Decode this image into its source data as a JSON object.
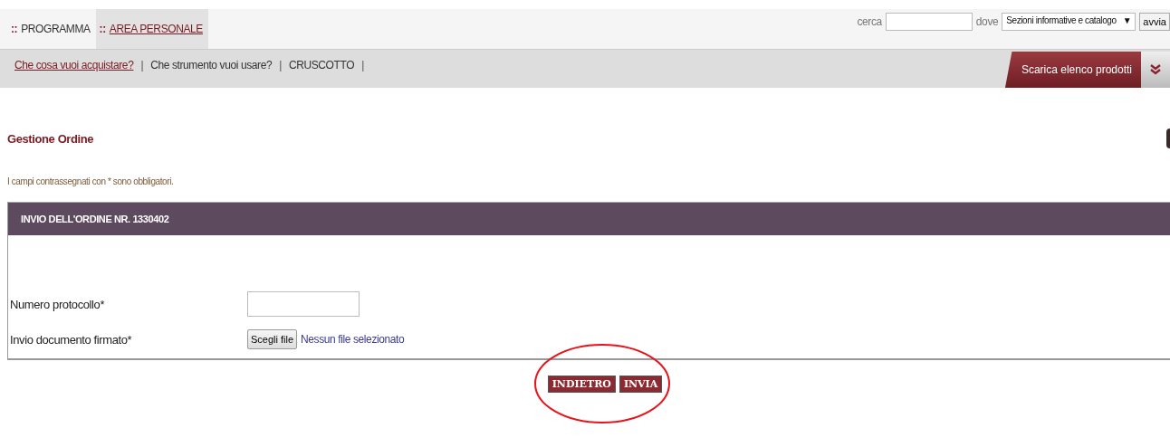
{
  "tabs": [
    {
      "marker": "::",
      "label": "PROGRAMMA",
      "selected": false
    },
    {
      "marker": "::",
      "label": "AREA PERSONALE",
      "selected": true
    }
  ],
  "search": {
    "label": "cerca",
    "where_label": "dove",
    "scope": "Sezioni informative e catalogo",
    "scope_arrow": "▼",
    "button": "avvia"
  },
  "subnav": {
    "links": [
      {
        "label": "Che cosa vuoi acquistare?",
        "selected": true
      },
      {
        "label": "Che strumento vuoi usare?",
        "selected": false
      },
      {
        "label": "CRUSCOTTO",
        "selected": false
      }
    ],
    "separator": "|",
    "download_button": "Scarica elenco prodotti"
  },
  "page_title": "Gestione Ordine",
  "required_note": "I campi contrassegnati con * sono obbligatori.",
  "form": {
    "header": "INVIO DELL'ORDINE NR. 1330402",
    "fields": [
      {
        "kind": "text",
        "label": "Numero protocollo*"
      },
      {
        "kind": "file",
        "label": "Invio documento firmato*",
        "button": "Scegli file",
        "status": "Nessun file selezionato"
      }
    ]
  },
  "actions": {
    "buttons": [
      "INDIETRO",
      "INVIA"
    ],
    "circled": true
  }
}
